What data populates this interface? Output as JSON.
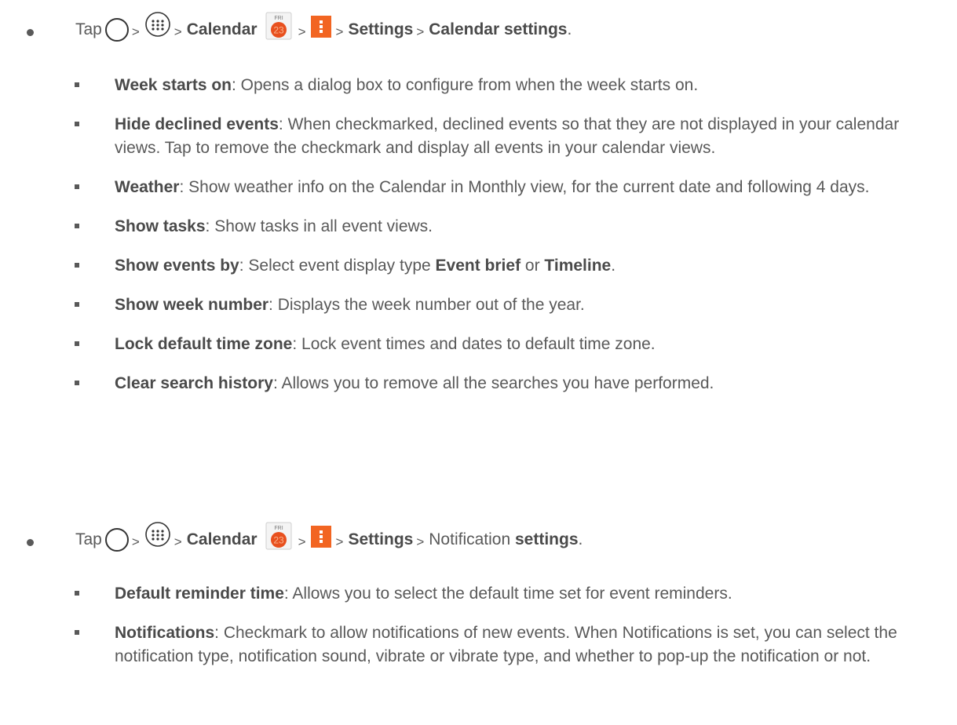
{
  "step1": {
    "tap": "Tap",
    "gt": ">",
    "calendar": "Calendar",
    "settings": "Settings",
    "target": "Calendar settings",
    "period": "."
  },
  "calendar_icon": {
    "day": "FRI",
    "date": "23"
  },
  "items1": [
    {
      "term": "Week starts on",
      "desc": ": Opens a dialog box to configure from when the week starts on."
    },
    {
      "term": "Hide declined events",
      "desc": ": When checkmarked, declined events so that they are not displayed in your calendar views. Tap to remove the checkmark and display all events in your calendar views."
    },
    {
      "term": "Weather",
      "desc": ": Show weather info on the Calendar in Monthly view, for the current date and following 4 days."
    },
    {
      "term": "Show tasks",
      "desc": ": Show tasks in all event views."
    },
    {
      "term": "Show events by",
      "desc": ": Select event display type ",
      "b2": "Event brief",
      "mid": " or ",
      "b3": "Timeline",
      "end": "."
    },
    {
      "term": "Show week number",
      "desc": ": Displays the week number out of the year."
    },
    {
      "term": "Lock default time zone",
      "desc": ": Lock event times and dates to default time zone."
    },
    {
      "term": "Clear search history",
      "desc": ": Allows you to remove all the searches you have performed."
    }
  ],
  "step2": {
    "tap": "Tap",
    "gt": ">",
    "calendar": "Calendar",
    "settings": "Settings",
    "plain": "Notification",
    "target": "settings",
    "period": "."
  },
  "items2": [
    {
      "term": "Default reminder time",
      "desc": ": Allows you to select the default time set for event reminders."
    },
    {
      "term": "Notifications",
      "desc": ": Checkmark to allow notifications of new events. When Notifications is set, you can select the notification type, notification sound, vibrate or vibrate type, and whether to pop-up the notification or not."
    }
  ],
  "colors": {
    "text": "#595959",
    "menu_icon": "#f26522",
    "calendar_date": "#e8501e"
  }
}
